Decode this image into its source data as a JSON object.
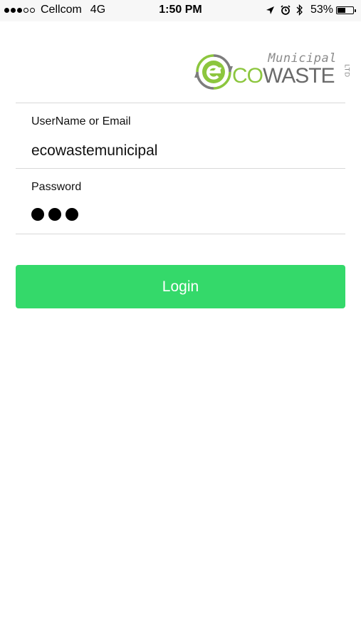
{
  "status_bar": {
    "carrier": "Cellcom",
    "network": "4G",
    "time": "1:50 PM",
    "battery_percent": "53%",
    "battery_level": 0.53,
    "signal_bars_on": 3,
    "signal_bars_total": 5,
    "icons": [
      "location-arrow-icon",
      "alarm-icon",
      "bluetooth-icon",
      "battery-icon"
    ]
  },
  "logo": {
    "municipal": "Municipal",
    "co": "CO",
    "waste": "WASTE",
    "suffix": "LTD",
    "colors": {
      "green": "#8cc63e",
      "gray": "#6a6a6a",
      "light_gray": "#8a8a8a"
    }
  },
  "form": {
    "username": {
      "label": "UserName or Email",
      "value": "ecowastemunicipal"
    },
    "password": {
      "label": "Password",
      "masked_length": 3
    }
  },
  "login_button": {
    "label": "Login",
    "color": "#34d96a"
  }
}
